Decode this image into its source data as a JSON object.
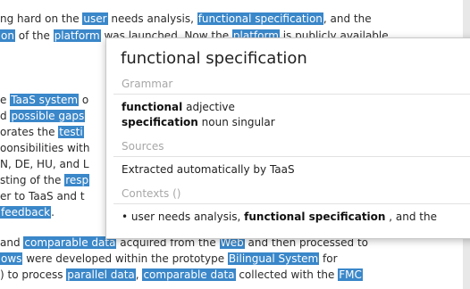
{
  "document": {
    "lines": [
      {
        "parts": [
          {
            "t": "ng hard on the "
          },
          {
            "t": "user",
            "hl": true
          },
          {
            "t": " needs analysis, "
          },
          {
            "t": "functional specification",
            "hl": true
          },
          {
            "t": ", and the"
          }
        ]
      },
      {
        "parts": [
          {
            "t": "on",
            "hl": true
          },
          {
            "t": " of the "
          },
          {
            "t": "platform",
            "hl": true
          },
          {
            "t": " was launched. Now the "
          },
          {
            "t": "platform",
            "hl": true
          },
          {
            "t": " is publicly available"
          }
        ]
      },
      {
        "parts": [
          {
            "t": "e "
          },
          {
            "t": "TaaS system",
            "hl": true
          },
          {
            "t": " o"
          }
        ]
      },
      {
        "parts": [
          {
            "t": "d "
          },
          {
            "t": "possible gaps",
            "hl": true
          }
        ]
      },
      {
        "parts": [
          {
            "t": "orates the "
          },
          {
            "t": "testi",
            "hl": true
          }
        ]
      },
      {
        "parts": [
          {
            "t": "oonsibilities with"
          }
        ]
      },
      {
        "parts": [
          {
            "t": "N, DE, HU, and L"
          }
        ]
      },
      {
        "parts": [
          {
            "t": "sting of the "
          },
          {
            "t": "resp",
            "hl": true
          }
        ]
      },
      {
        "parts": [
          {
            "t": "er to TaaS and t"
          }
        ]
      },
      {
        "parts": [
          {
            "t": "feedback",
            "hl": true
          },
          {
            "t": "."
          }
        ]
      },
      {
        "parts": [
          {
            "t": " and "
          },
          {
            "t": "comparable data",
            "hl": true
          },
          {
            "t": " acquired from the "
          },
          {
            "t": "Web",
            "hl": true
          },
          {
            "t": " and then processed to"
          }
        ]
      },
      {
        "parts": [
          {
            "t": "ows",
            "hl": true
          },
          {
            "t": " were developed within the prototype "
          },
          {
            "t": "Bilingual System",
            "hl": true
          },
          {
            "t": " for"
          }
        ]
      },
      {
        "parts": [
          {
            "t": ") to process "
          },
          {
            "t": "parallel data",
            "hl": true
          },
          {
            "t": ", "
          },
          {
            "t": "comparable data",
            "hl": true
          },
          {
            "t": " collected with the "
          },
          {
            "t": "FMC",
            "hl": true
          }
        ]
      }
    ]
  },
  "popup": {
    "term": "functional specification",
    "grammar_heading": "Grammar",
    "grammar": [
      {
        "word": "functional",
        "pos": "adjective"
      },
      {
        "word": "specification",
        "pos": "noun singular"
      }
    ],
    "sources_heading": "Sources",
    "source_text": "Extracted automatically by TaaS",
    "contexts_heading": "Contexts ()",
    "context": {
      "bullet": "•",
      "before": "user needs analysis, ",
      "term": "functional specification",
      "after": " , and the"
    }
  }
}
